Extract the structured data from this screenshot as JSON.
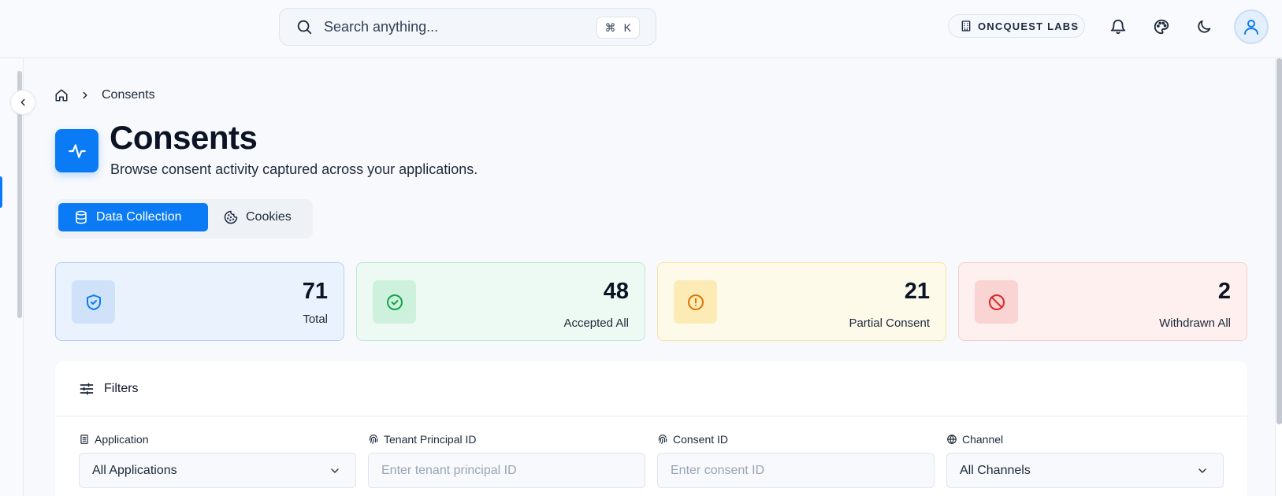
{
  "topbar": {
    "search_placeholder": "Search anything...",
    "shortcut_symbol": "⌘",
    "shortcut_key": "K",
    "org_name": "ONCQUEST LABS"
  },
  "breadcrumb": {
    "current": "Consents"
  },
  "header": {
    "title": "Consents",
    "subtitle": "Browse consent activity captured across your applications."
  },
  "tabs": [
    {
      "label": "Data Collection",
      "active": true,
      "icon": "database-icon"
    },
    {
      "label": "Cookies",
      "active": false,
      "icon": "cookie-icon"
    }
  ],
  "stats": [
    {
      "value": "71",
      "label": "Total",
      "icon": "shield-check-icon",
      "color": "#0b7bf5"
    },
    {
      "value": "48",
      "label": "Accepted All",
      "icon": "check-circle-icon",
      "color": "#16a34a"
    },
    {
      "value": "21",
      "label": "Partial Consent",
      "icon": "alert-circle-icon",
      "color": "#d97706"
    },
    {
      "value": "2",
      "label": "Withdrawn All",
      "icon": "ban-icon",
      "color": "#dc2626"
    }
  ],
  "filters": {
    "title": "Filters",
    "fields": [
      {
        "label": "Application",
        "value": "All Applications",
        "type": "select"
      },
      {
        "label": "Tenant Principal ID",
        "placeholder": "Enter tenant principal ID",
        "type": "input"
      },
      {
        "label": "Consent ID",
        "placeholder": "Enter consent ID",
        "type": "input"
      },
      {
        "label": "Channel",
        "value": "All Channels",
        "type": "select"
      }
    ]
  },
  "colors": {
    "accent": "#0b7bf5"
  }
}
